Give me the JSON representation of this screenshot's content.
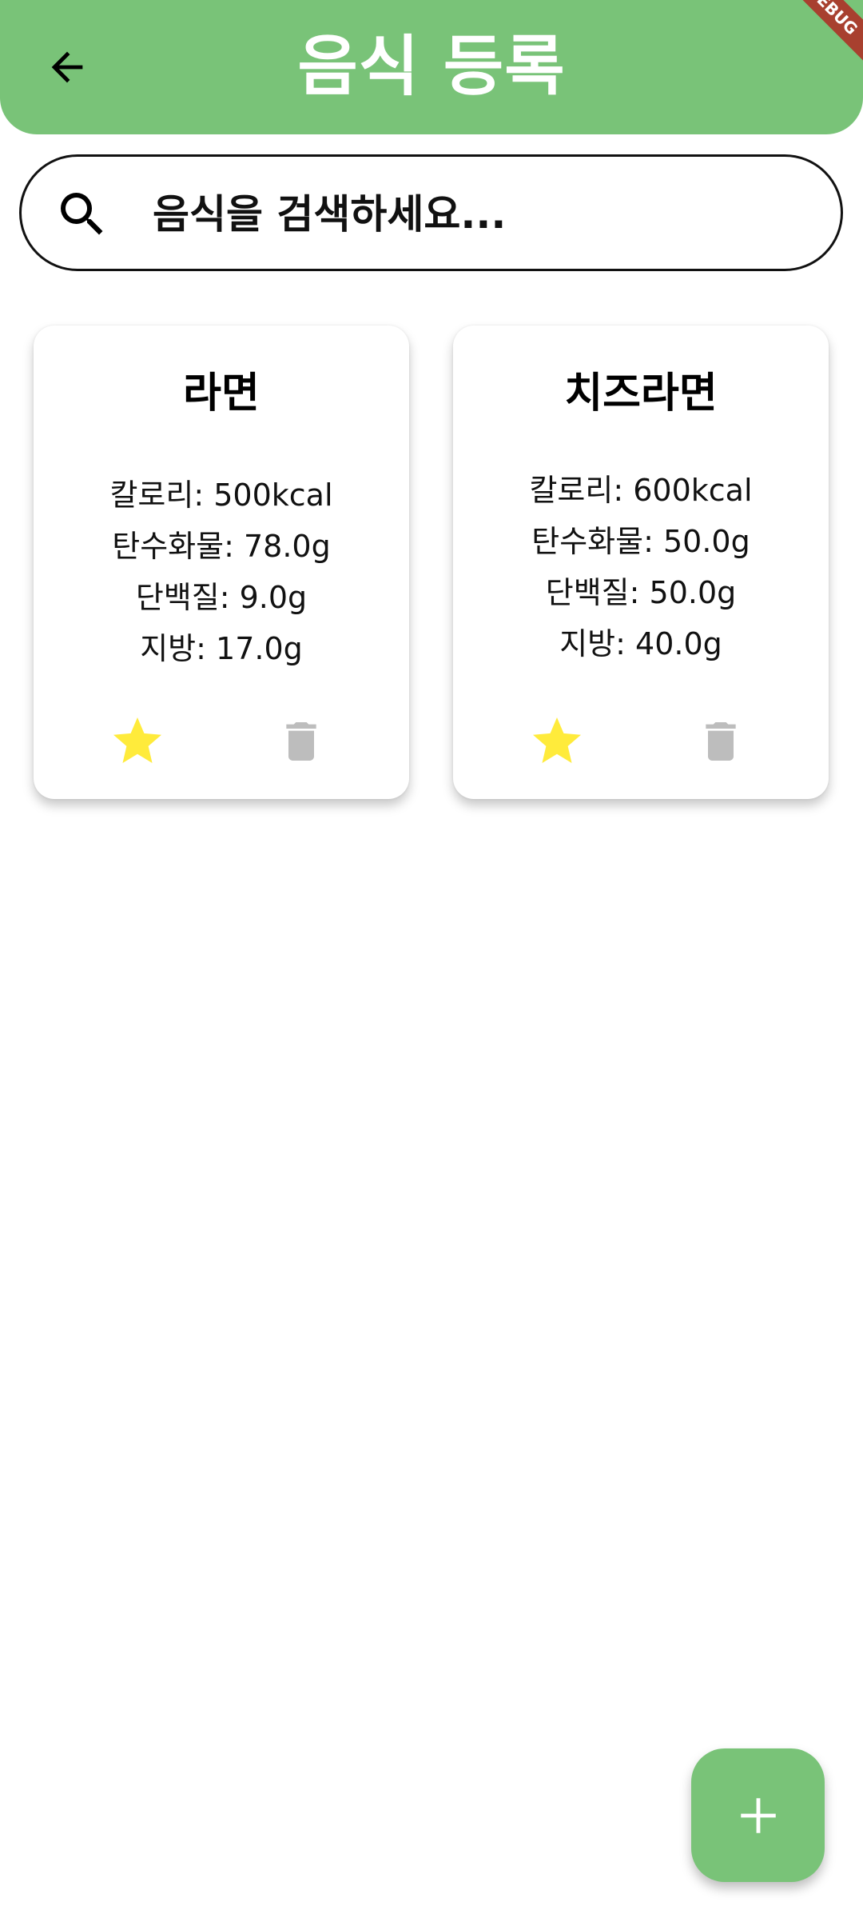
{
  "appbar": {
    "title": "음식 등록",
    "debug_banner": "DEBUG",
    "color": "#79c378"
  },
  "search": {
    "placeholder": "음식을 검색하세요..."
  },
  "foods": [
    {
      "name": "라면",
      "calories": "칼로리: 500kcal",
      "carbs": "탄수화물: 78.0g",
      "protein": "단백질: 9.0g",
      "fat": "지방: 17.0g",
      "favorite": true
    },
    {
      "name": "치즈라면",
      "calories": "칼로리: 600kcal",
      "carbs": "탄수화물: 50.0g",
      "protein": "단백질: 50.0g",
      "fat": "지방: 40.0g",
      "favorite": true
    }
  ],
  "colors": {
    "star": "#ffeb3b",
    "trash": "#bdbdbd"
  },
  "icons": {
    "back": "arrow-back-icon",
    "search": "search-icon",
    "favorite": "star-icon",
    "delete": "trash-icon",
    "add": "plus-icon"
  }
}
